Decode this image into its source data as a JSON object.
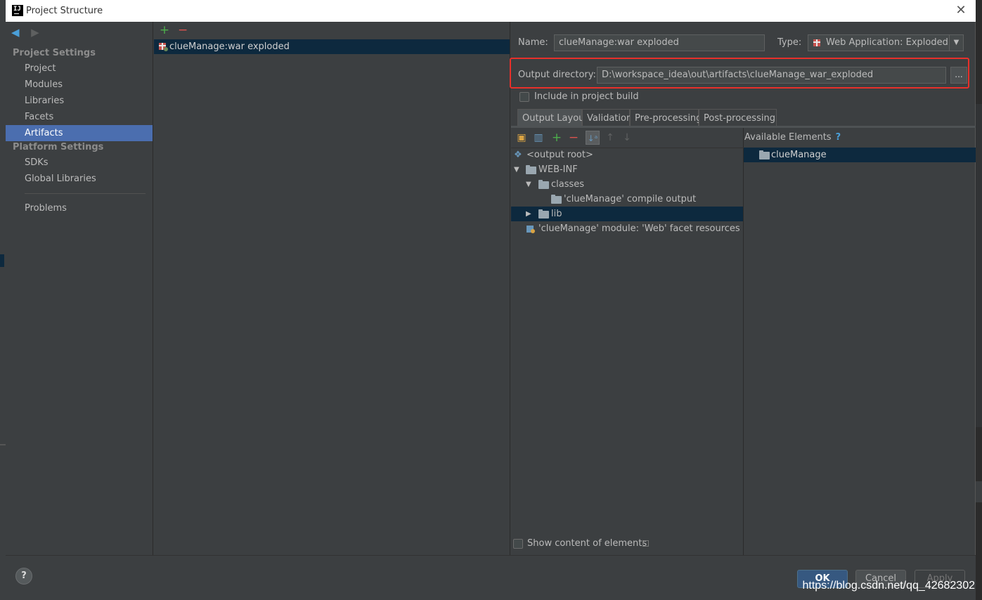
{
  "window": {
    "title": "Project Structure",
    "close_glyph": "✕"
  },
  "nav": {
    "project_settings_header": "Project Settings",
    "project_items": [
      "Project",
      "Modules",
      "Libraries",
      "Facets",
      "Artifacts"
    ],
    "platform_settings_header": "Platform Settings",
    "platform_items": [
      "SDKs",
      "Global Libraries"
    ],
    "problems": "Problems",
    "selected": "Artifacts"
  },
  "artifacts": {
    "add_glyph": "+",
    "remove_glyph": "−",
    "items": [
      "clueManage:war exploded"
    ]
  },
  "form": {
    "name_label": "Name:",
    "name_value": "clueManage:war exploded",
    "type_label": "Type:",
    "type_value": "Web Application: Exploded",
    "output_dir_label": "Output directory:",
    "output_dir_value": "D:\\workspace_idea\\out\\artifacts\\clueManage_war_exploded",
    "browse_label": "...",
    "include_build_label": "Include in project build",
    "include_build_checked": false
  },
  "tabs": [
    "Output Layout",
    "Validation",
    "Pre-processing",
    "Post-processing"
  ],
  "active_tab": "Output Layout",
  "layout_tree": [
    {
      "label": "<output root>",
      "kind": "root"
    },
    {
      "label": "WEB-INF",
      "kind": "folder",
      "expanded": true
    },
    {
      "label": "classes",
      "kind": "folder",
      "expanded": true
    },
    {
      "label": "'clueManage' compile output",
      "kind": "module-output"
    },
    {
      "label": "lib",
      "kind": "folder",
      "expanded": false,
      "selected": true
    },
    {
      "label": "'clueManage' module: 'Web' facet resources",
      "kind": "facet"
    }
  ],
  "available": {
    "header": "Available Elements",
    "help_glyph": "?",
    "items": [
      "clueManage"
    ]
  },
  "show_content_label": "Show content of elements",
  "buttons": {
    "help": "?",
    "ok": "OK",
    "cancel": "Cancel",
    "apply": "Apply"
  },
  "watermark": "https://blog.csdn.net/qq_42682302",
  "colors": {
    "selection": "#4b6eaf",
    "tree_selection": "#0d293e",
    "highlight_box": "#e8302a",
    "ok_button": "#365880"
  }
}
